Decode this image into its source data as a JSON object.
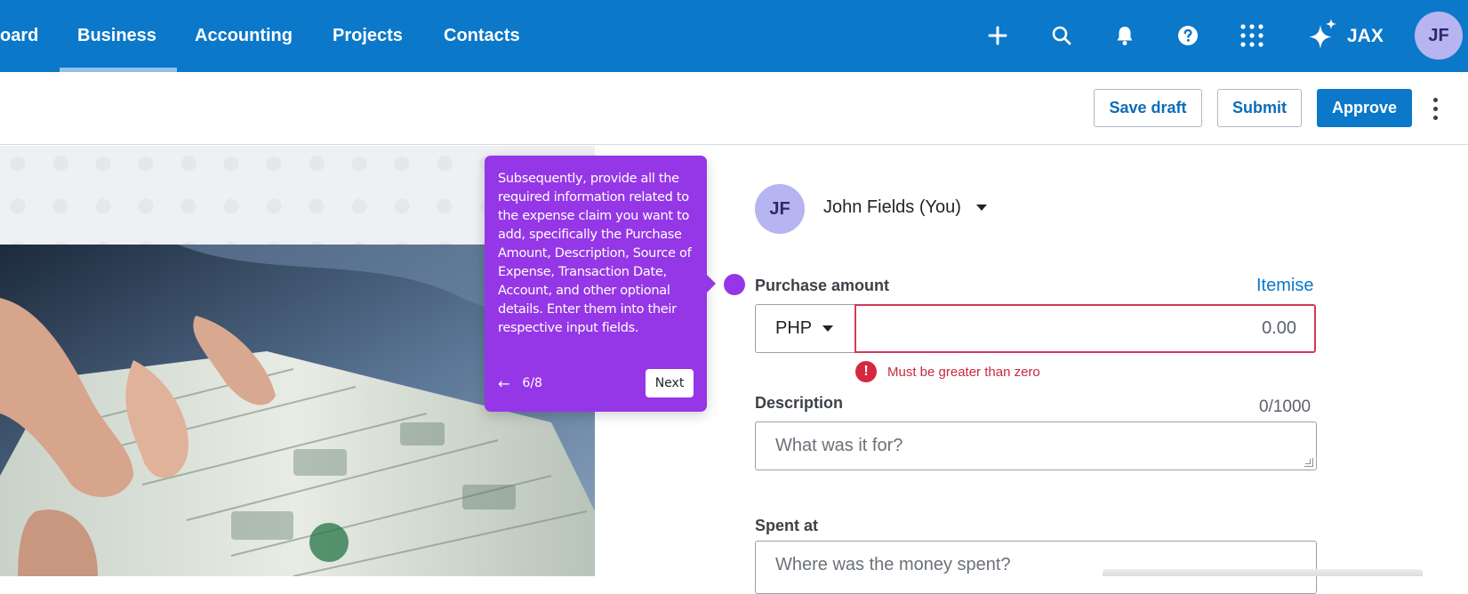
{
  "nav": {
    "items": [
      {
        "label": "oard"
      },
      {
        "label": "Business"
      },
      {
        "label": "Accounting"
      },
      {
        "label": "Projects"
      },
      {
        "label": "Contacts"
      }
    ],
    "active": "Business",
    "icons": [
      "plus-icon",
      "search-icon",
      "bell-icon",
      "help-icon",
      "app-grid-icon",
      "sparkle-icon"
    ],
    "jax_label": "JAX",
    "user_initials": "JF",
    "brand_color": "#0b78c9"
  },
  "actions": {
    "save_draft": "Save draft",
    "submit": "Submit",
    "approve": "Approve"
  },
  "form": {
    "user": {
      "initials": "JF",
      "name": "John Fields (You)"
    },
    "purchase_amount": {
      "label": "Purchase amount",
      "itemise": "Itemise",
      "currency": "PHP",
      "value": "0.00",
      "error": "Must be greater than zero"
    },
    "description": {
      "label": "Description",
      "counter": "0/1000",
      "placeholder": "What was it for?"
    },
    "spent_at": {
      "label": "Spent at",
      "placeholder": "Where was the money spent?"
    }
  },
  "tooltip": {
    "text": "Subsequently, provide all the required information related to the expense claim you want to add, specifically the Purchase Amount, Description, Source of Expense, Transaction Date, Account, and other optional details. Enter them into their respective input fields.",
    "step": "6/8",
    "next": "Next",
    "color": "#9537e6"
  },
  "error_color": "#d5283f"
}
